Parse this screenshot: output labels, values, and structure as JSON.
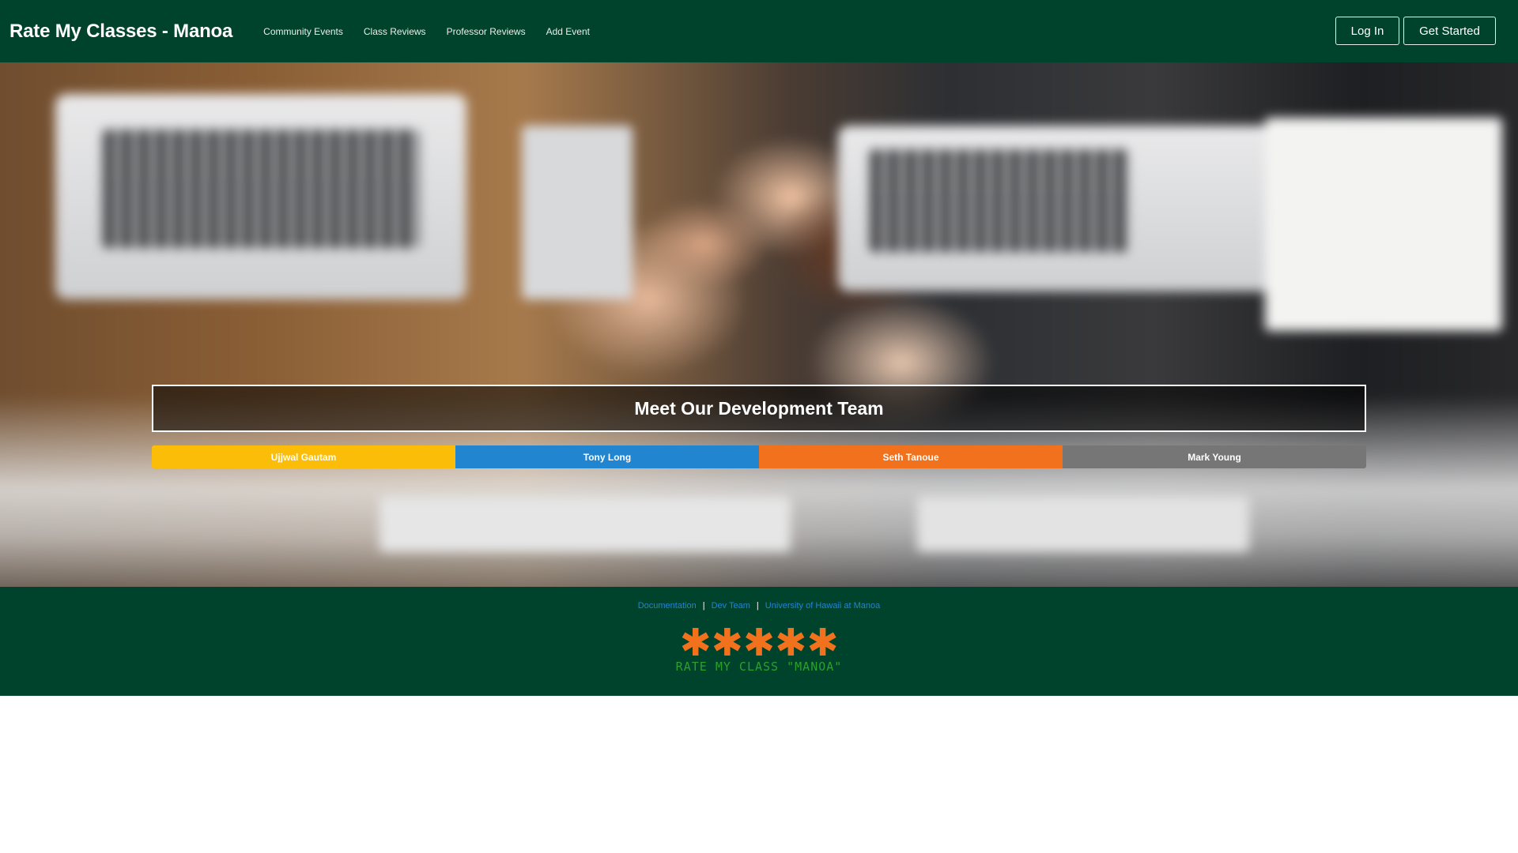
{
  "navbar": {
    "brand": "Rate My Classes - Manoa",
    "links": [
      "Community Events",
      "Class Reviews",
      "Professor Reviews",
      "Add Event"
    ],
    "login_label": "Log In",
    "get_started_label": "Get Started"
  },
  "hero": {
    "title": "Meet Our Development Team",
    "members": [
      "Ujjwal Gautam",
      "Tony Long",
      "Seth Tanoue",
      "Mark Young"
    ]
  },
  "footer": {
    "links": [
      "Documentation",
      "Dev Team",
      "University of Hawaii at Manoa"
    ],
    "separator": "|",
    "logo_stars": "✱✱✱✱✱",
    "logo_text": "RATE MY CLASS \"MANOA\""
  },
  "colors": {
    "primary_green": "#00432c",
    "member_yellow": "#fbbd08",
    "member_blue": "#2185d0",
    "member_orange": "#f2711c",
    "member_grey": "#767676",
    "link_blue": "#2185d0"
  }
}
